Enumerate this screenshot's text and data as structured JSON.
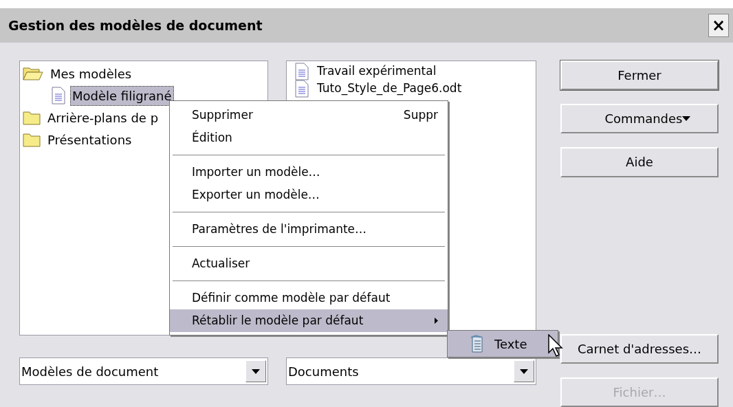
{
  "window": {
    "title": "Gestion des modèles de document",
    "close": "×"
  },
  "categories": [
    {
      "label": "Mes modèles",
      "kind": "folder",
      "expanded": true,
      "selected": false,
      "children": [
        {
          "label": "Modèle filigrané",
          "kind": "document",
          "selected": true
        }
      ]
    },
    {
      "label": "Arrière-plans de p",
      "kind": "folder",
      "expanded": false,
      "selected": false
    },
    {
      "label": "Présentations",
      "kind": "folder",
      "expanded": false,
      "selected": false
    }
  ],
  "documents": [
    {
      "label": "Travail expérimental"
    },
    {
      "label": "Tuto_Style_de_Page6.odt"
    }
  ],
  "category_select": {
    "value": "Modèles de document"
  },
  "document_select": {
    "value": "Documents"
  },
  "buttons": [
    {
      "label": "Fermer",
      "kind": "default",
      "disabled": false
    },
    {
      "label": "Commandes",
      "kind": "menu",
      "disabled": false
    },
    {
      "label": "Aide",
      "kind": "plain",
      "disabled": false
    },
    {
      "label": "Carnet d'adresses…",
      "kind": "plain",
      "disabled": false
    },
    {
      "label": "Fichier…",
      "kind": "plain",
      "disabled": true
    }
  ],
  "context_menu": [
    {
      "kind": "item",
      "label": "Supprimer",
      "shortcut": "Suppr",
      "selected": false
    },
    {
      "kind": "item",
      "label": "Édition",
      "selected": false
    },
    {
      "kind": "separator"
    },
    {
      "kind": "item",
      "label": "Importer un modèle…",
      "selected": false
    },
    {
      "kind": "item",
      "label": "Exporter un modèle…",
      "selected": false
    },
    {
      "kind": "separator"
    },
    {
      "kind": "item",
      "label": "Paramètres de l'imprimante…",
      "selected": false
    },
    {
      "kind": "separator"
    },
    {
      "kind": "item",
      "label": "Actualiser",
      "selected": false
    },
    {
      "kind": "separator"
    },
    {
      "kind": "item",
      "label": "Définir comme modèle par défaut",
      "selected": false
    },
    {
      "kind": "submenu",
      "label": "Rétablir le modèle par défaut",
      "selected": true
    }
  ],
  "submenu": [
    {
      "label": "Texte",
      "selected": true
    }
  ]
}
